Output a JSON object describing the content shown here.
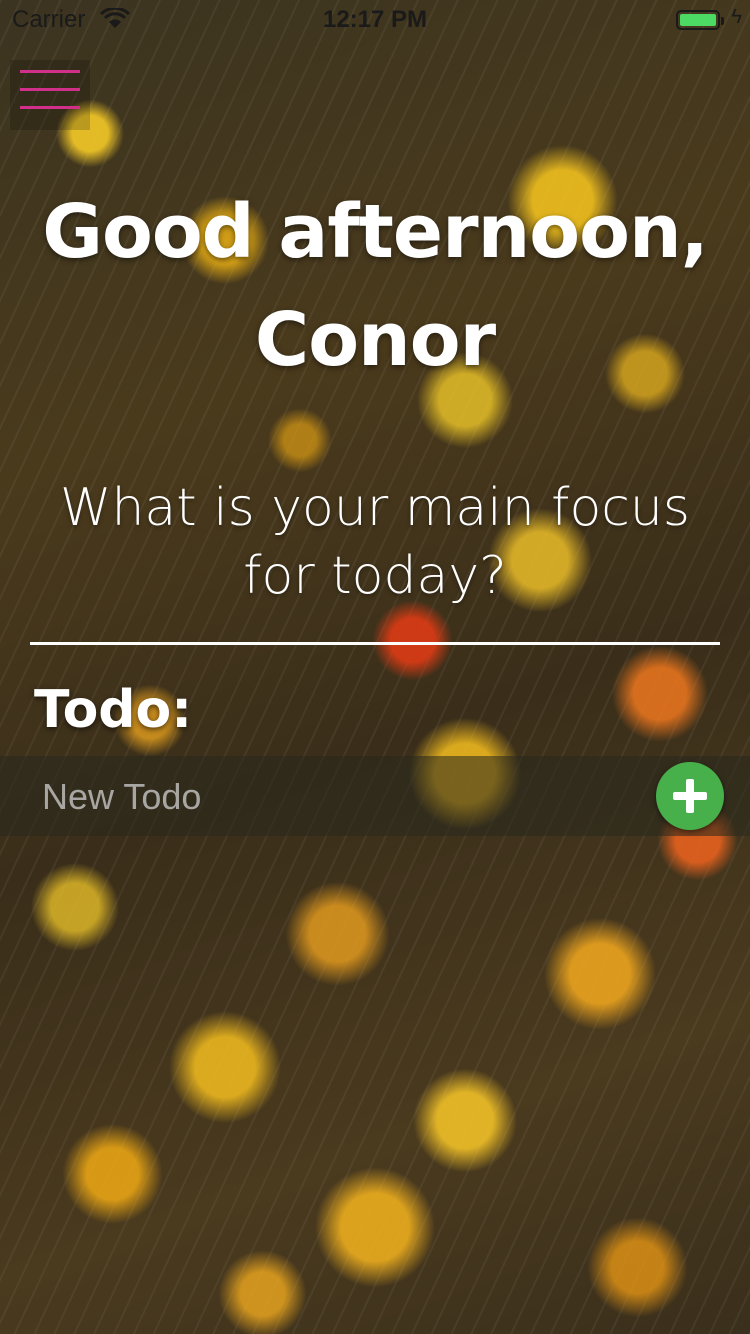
{
  "status_bar": {
    "carrier": "Carrier",
    "time": "12:17 PM",
    "battery_level": 1.0,
    "battery_color": "#4cd964",
    "wifi_icon": "wifi-icon",
    "charging_icon": "bolt-icon"
  },
  "menu": {
    "icon": "hamburger-menu-icon",
    "accent_color": "#d0308a"
  },
  "greeting": {
    "line1": "Good afternoon,",
    "line2": "Conor"
  },
  "focus": {
    "question_line1": "What is your main focus",
    "question_line2": "for today?",
    "value": ""
  },
  "todo": {
    "heading": "Todo:",
    "new_placeholder": "New Todo",
    "add_icon": "plus-icon",
    "add_button_color": "#47b04b"
  }
}
